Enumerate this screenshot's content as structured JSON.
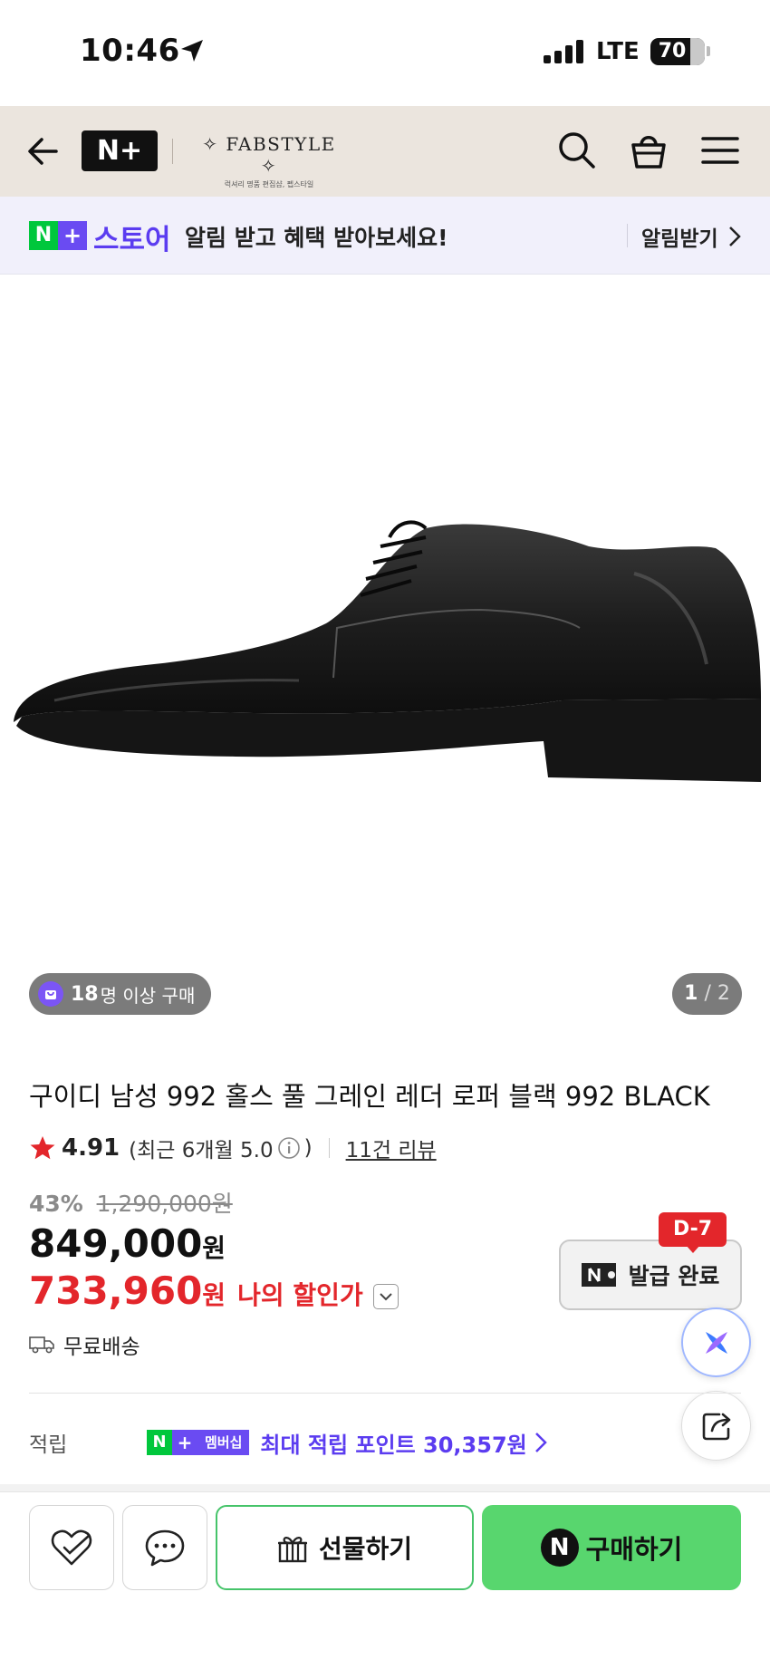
{
  "status_bar": {
    "time": "10:46",
    "network": "LTE",
    "battery": "70"
  },
  "header": {
    "brand_logo": "N+",
    "brand_name": "FABSTYLE",
    "brand_sub": "럭셔리 명품 편집샵, 펩스타일",
    "icons": [
      "back-arrow-icon",
      "search-icon",
      "basket-icon",
      "menu-icon"
    ],
    "background": "#ebe5de"
  },
  "banner": {
    "badge_n": "N",
    "badge_plus": "+",
    "store_word": "스토어",
    "message": "알림 받고 혜택 받아보세요!",
    "action": "알림받기"
  },
  "gallery": {
    "buyers_count": "18",
    "buyers_text": "명 이상 구매",
    "page_current": "1",
    "page_total": "2"
  },
  "product": {
    "title": "구이디 남성 992 홀스 풀 그레인 레더 로퍼 블랙 992 BLACK",
    "rating": "4.91",
    "recent_rating": "(최근 6개월 5.0",
    "recent_close": ")",
    "review_count": "11건 리뷰",
    "discount_rate": "43%",
    "original_price": "1,290,000원",
    "price": "849,000",
    "price_unit": "원",
    "my_price": "733,960",
    "my_price_unit": "원",
    "my_price_label": "나의 할인가",
    "shipping": "무료배송"
  },
  "coupon": {
    "dday": "D-7",
    "label": "발급 완료"
  },
  "points": {
    "label": "적립",
    "badge_n": "N",
    "badge_plus": "+",
    "badge_text": "멤버십",
    "value": "최대 적립 포인트 30,357원"
  },
  "bottom_bar": {
    "gift_label": "선물하기",
    "buy_badge": "N",
    "buy_label": "구매하기"
  },
  "colors": {
    "accent_purple": "#5b3cf0",
    "naver_green": "#00c73c",
    "buy_green": "#58d66e",
    "sale_red": "#e3262b"
  }
}
